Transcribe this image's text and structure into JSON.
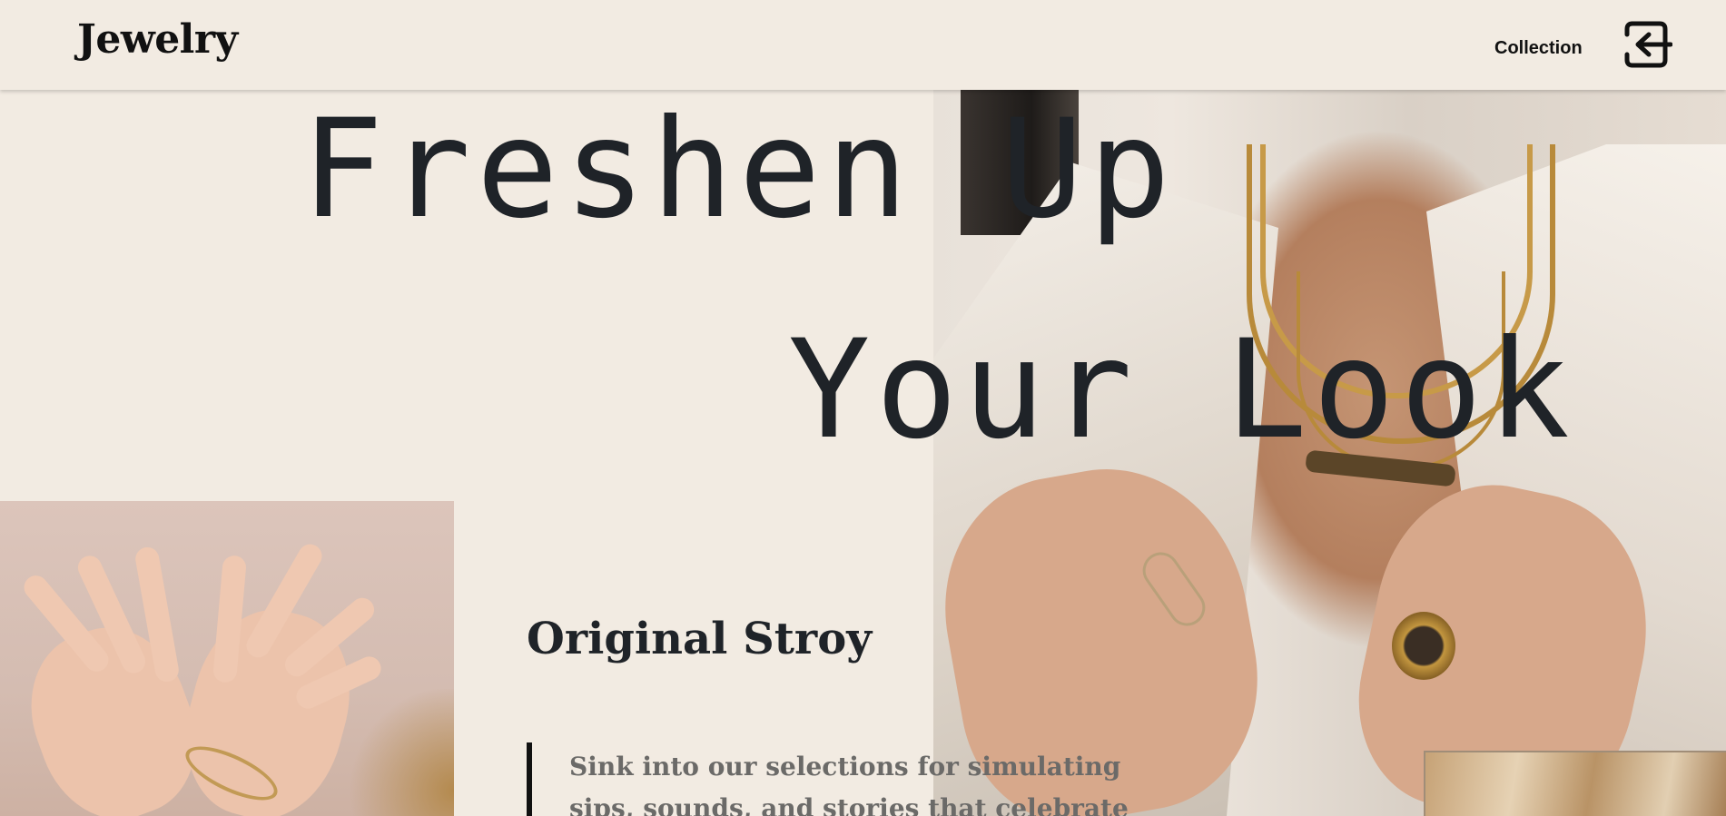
{
  "header": {
    "logo": "Jewelry",
    "nav": {
      "collection_label": "Collection"
    },
    "login_icon": "sign-in-icon"
  },
  "hero": {
    "headline_line1": "Freshen Up",
    "headline_line2": "Your Look"
  },
  "story": {
    "title": "Original Stroy",
    "text": "Sink into our selections for simulating sips, sounds, and stories that celebrate"
  },
  "colors": {
    "background": "#f2ebe2",
    "text": "#1f2328",
    "muted_text": "#6b6a68",
    "accent_bar": "#111111"
  }
}
